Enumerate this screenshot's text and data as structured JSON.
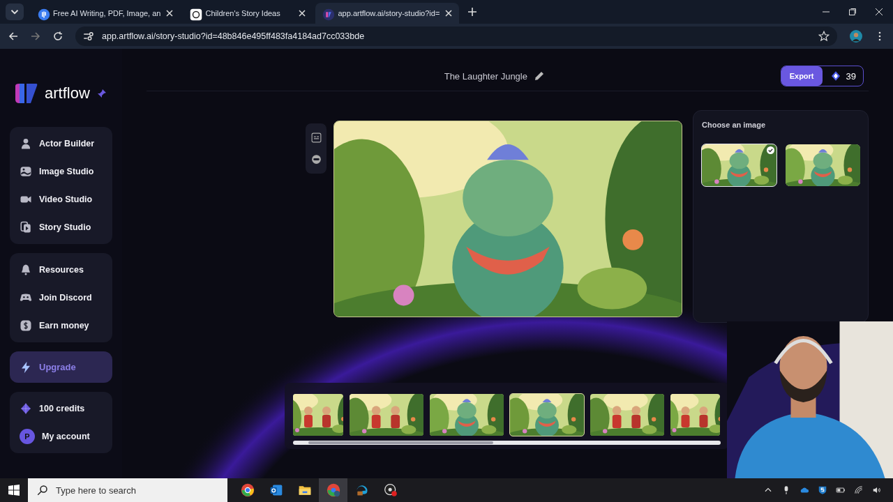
{
  "browser": {
    "tabs": [
      {
        "title": "Free AI Writing, PDF, Image, an",
        "selected": false
      },
      {
        "title": "Children's Story Ideas",
        "selected": false
      },
      {
        "title": "app.artflow.ai/story-studio?id=",
        "selected": true
      }
    ],
    "address": "app.artflow.ai/story-studio?id=48b846e495ff483fa4184ad7cc033bde"
  },
  "sidebar": {
    "logo": "artflow",
    "groups": [
      [
        {
          "label": "Actor Builder"
        },
        {
          "label": "Image Studio"
        },
        {
          "label": "Video Studio"
        },
        {
          "label": "Story Studio"
        }
      ],
      [
        {
          "label": "Resources"
        },
        {
          "label": "Join Discord"
        },
        {
          "label": "Earn money"
        }
      ]
    ],
    "upgrade": "Upgrade",
    "credits": "100 credits",
    "account": {
      "initial": "P",
      "label": "My account"
    }
  },
  "header": {
    "title": "The Laughter Jungle",
    "export": "Export",
    "credits": "39"
  },
  "chooser": {
    "title": "Choose an image",
    "options": [
      {
        "selected": true
      },
      {
        "selected": false
      }
    ]
  },
  "filmstrip": {
    "frames": [
      {
        "selected": false
      },
      {
        "selected": false
      },
      {
        "selected": false
      },
      {
        "selected": true
      },
      {
        "selected": false
      },
      {
        "selected": false
      }
    ]
  },
  "taskbar": {
    "search_placeholder": "Type here to search"
  }
}
